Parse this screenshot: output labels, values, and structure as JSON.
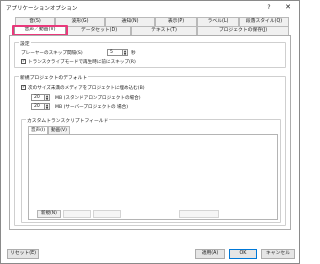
{
  "window": {
    "title": "アプリケーションオプション",
    "help_label": "?",
    "close_label": "✕"
  },
  "tabs_row1": [
    "音(S)",
    "波形(G)",
    "通知(N)",
    "表示(P)",
    "ラベル(L)",
    "段落スタイル(Q)"
  ],
  "tabs_row2": [
    "音声／動画(V)",
    "データセット(D)",
    "テキスト(T)",
    "プロジェクトの保存(J)"
  ],
  "general": {
    "title": "設定",
    "skip_label": "プレーヤーのスキップ間隔(S)",
    "skip_value": "5",
    "skip_unit": "秒",
    "transcribe_check_label": "トランスクライブモードで再生時に前にスキップ(R)",
    "transcribe_checked": "✓"
  },
  "new_project": {
    "title": "新規プロジェクトのデフォルト",
    "embed_check_label": "次のサイズ未満のメディアをプロジェクトに埋め込む(B)",
    "embed_checked": "✓",
    "standalone_value": "20",
    "standalone_label": "MB (スタンドアロンプロジェクトの場合)",
    "server_value": "20",
    "server_label": "MB (サーバープロジェクトの 場合)"
  },
  "custom_fields": {
    "title": "カスタムトランスクリプトフィールド",
    "tabs": [
      "音声(I)",
      "動画(V)"
    ],
    "buttons": [
      "新規(N)",
      "",
      "",
      ""
    ]
  },
  "footer": {
    "reset_label": "リセット(E)",
    "apply_label": "適用(A)",
    "ok_label": "OK",
    "cancel_label": "キャンセル"
  },
  "colors": {
    "highlight": "#e9397b",
    "default_button_border": "#0078d7"
  }
}
